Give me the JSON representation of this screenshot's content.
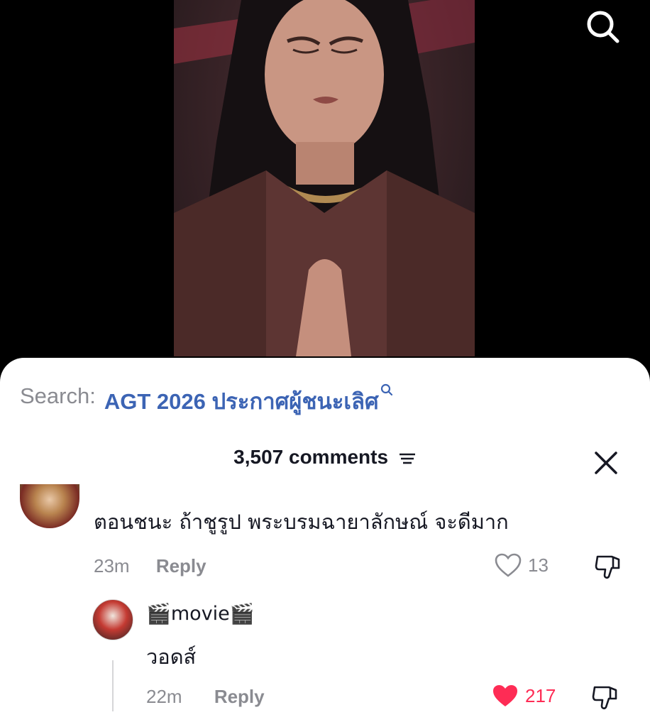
{
  "search": {
    "prefix": "Search:",
    "query": "AGT 2026 ประกาศผู้ชนะเลิศ"
  },
  "comments_header": {
    "count_label": "3,507 comments"
  },
  "comment": {
    "text": "ตอนชนะ ถ้าชูรูป พระบรมฉายาลักษณ์ จะดีมาก",
    "time": "23m",
    "reply_label": "Reply",
    "likes": "13"
  },
  "reply": {
    "author": "movie",
    "text": "วอดส์",
    "time": "22m",
    "reply_label": "Reply",
    "likes": "217",
    "liked": true
  },
  "colors": {
    "link_blue": "#3c64b4",
    "liked_red": "#fe2c55",
    "muted": "#8a8b91",
    "text": "#161823"
  },
  "icons": [
    "search-icon",
    "sort-icon",
    "close-icon",
    "heart-icon",
    "dislike-icon",
    "clapperboard-icon"
  ]
}
